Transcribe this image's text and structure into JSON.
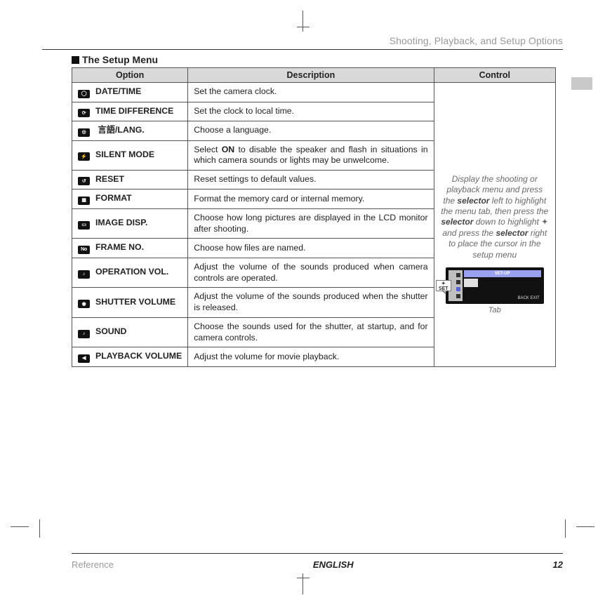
{
  "header": {
    "breadcrumb": "Shooting, Playback, and Setup Options"
  },
  "section": {
    "title": "The Setup Menu"
  },
  "table": {
    "headers": {
      "option": "Option",
      "description": "Description",
      "control": "Control"
    },
    "rows": [
      {
        "icon": "◯",
        "name": "DATE/TIME",
        "desc": "Set the camera clock."
      },
      {
        "icon": "⟳",
        "name": "TIME DIFFERENCE",
        "desc": "Set the clock to local time."
      },
      {
        "icon": "◎",
        "name": "言語/LANG.",
        "lang_prefix": "",
        "desc": "Choose a language."
      },
      {
        "icon": "⚡",
        "name": "SILENT MODE",
        "desc_pre": "Select ",
        "desc_bold": "ON",
        "desc_post": " to disable the speaker and flash in situations in which camera sounds or lights may be unwelcome."
      },
      {
        "icon": "↺",
        "name": "RESET",
        "desc": "Reset settings to default values."
      },
      {
        "icon": "▦",
        "name": "FORMAT",
        "desc": "Format the memory card or internal memory."
      },
      {
        "icon": "▭",
        "name": "IMAGE DISP.",
        "desc": "Choose how long pictures are displayed in the LCD monitor after shooting."
      },
      {
        "icon": "No",
        "name": "FRAME NO.",
        "desc": "Choose how files are named."
      },
      {
        "icon": "♪",
        "name": "OPERATION VOL.",
        "desc": "Adjust the volume of the sounds produced when camera controls are operated."
      },
      {
        "icon": "◉",
        "name": "SHUTTER VOLUME",
        "desc": "Adjust the volume of the sounds produced when the shutter is released."
      },
      {
        "icon": "♪",
        "name": "SOUND",
        "desc": "Choose the sounds used for the shutter, at startup, and for camera controls."
      },
      {
        "icon": "◀",
        "name": "PLAYBACK VOLUME",
        "desc": "Adjust the volume for movie playback."
      }
    ]
  },
  "control": {
    "text_parts": {
      "p1": "Display the shooting or playback menu and press the ",
      "sel1": "selector",
      "p2": " left to highlight the menu tab, then press the ",
      "sel2": "selector",
      "p3": " down to highlight ",
      "p4": " and press the ",
      "sel3": "selector",
      "p5": " right to place the cursor in the setup menu"
    },
    "lcd_title": "SET-UP",
    "lcd_exit": "BACK EXIT",
    "lcd_set_top": "✦",
    "lcd_set": "SET",
    "tab_label": "Tab"
  },
  "footer": {
    "ref": "Reference",
    "lang": "ENGLISH",
    "page": "12"
  }
}
